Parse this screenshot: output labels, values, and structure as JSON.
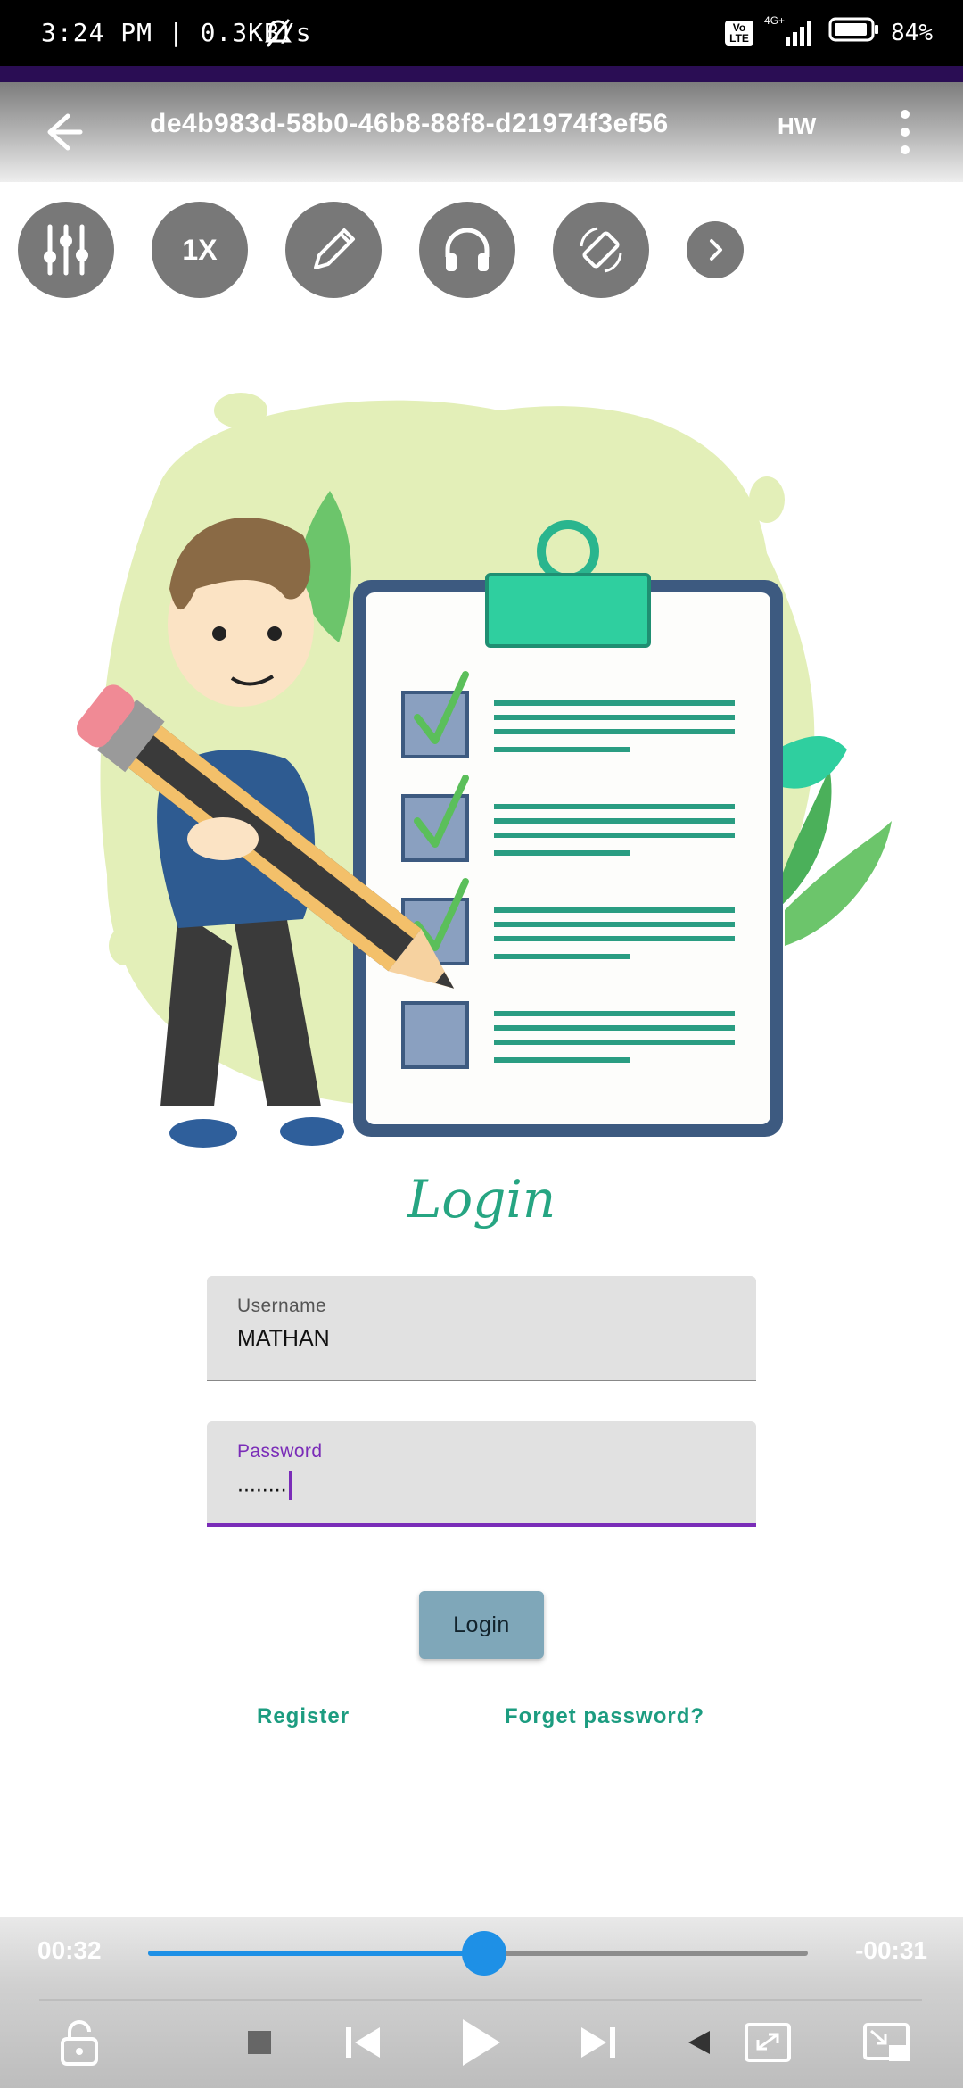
{
  "status_bar": {
    "time_speed": "3:24 PM | 0.3KB/s",
    "network_badge": "Vo LTE",
    "signal_label": "4G+",
    "battery": "84%"
  },
  "top_bar": {
    "title": "de4b983d-58b0-46b8-88f8-d21974f3ef56",
    "hw_label": "HW"
  },
  "toolbar": {
    "speed_label": "1X",
    "icons": [
      "equalizer-icon",
      "speed-icon",
      "pencil-icon",
      "headphones-icon",
      "rotate-screen-icon",
      "chevron-right-icon"
    ]
  },
  "login": {
    "title": "Login",
    "username": {
      "label": "Username",
      "value": "MATHAN"
    },
    "password": {
      "label": "Password",
      "value": "........"
    },
    "button_label": "Login",
    "register_link": "Register",
    "forget_link": "Forget password?"
  },
  "player": {
    "elapsed": "00:32",
    "remaining": "-00:31",
    "progress": 0.51,
    "accent_color": "#1e90e6"
  },
  "colors": {
    "accent_purple": "#7a2cb8",
    "accent_teal": "#26a582",
    "button": "#7fa7b9"
  }
}
